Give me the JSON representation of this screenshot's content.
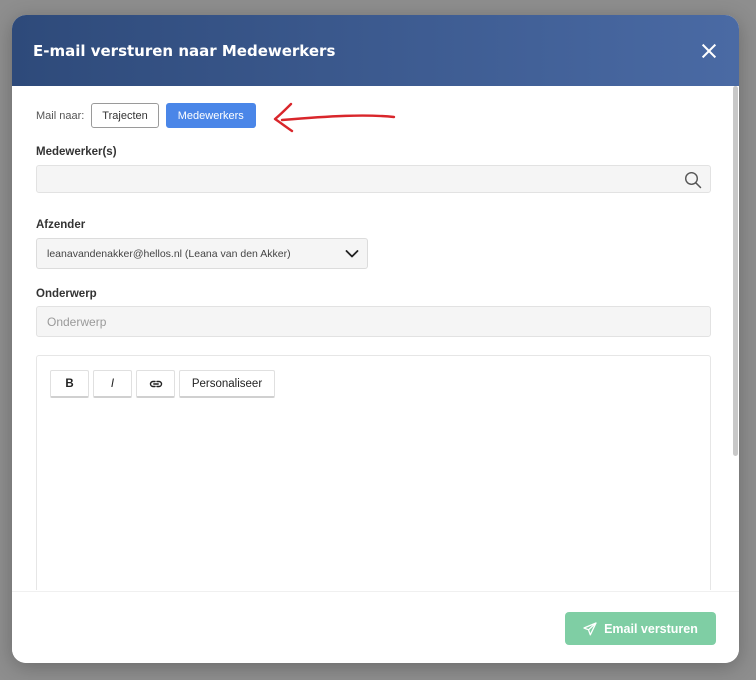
{
  "modal": {
    "title": "E-mail versturen naar Medewerkers"
  },
  "mail_to": {
    "label": "Mail naar:",
    "options": [
      "Trajecten",
      "Medewerkers"
    ],
    "selected": "Medewerkers"
  },
  "medewerkers": {
    "label": "Medewerker(s)",
    "value": ""
  },
  "afzender": {
    "label": "Afzender",
    "value": "leanavandenakker@hellos.nl (Leana van den Akker)"
  },
  "onderwerp": {
    "label": "Onderwerp",
    "placeholder": "Onderwerp",
    "value": ""
  },
  "editor": {
    "toolbar": {
      "bold": "B",
      "italic": "I",
      "link_icon": "link-icon",
      "personalize": "Personaliseer"
    },
    "content": ""
  },
  "footer": {
    "send_label": "Email versturen",
    "send_icon": "paper-plane-icon"
  },
  "colors": {
    "header_start": "#2e4a7a",
    "header_end": "#4a6aa4",
    "toggle_active": "#4a86e8",
    "send_button": "#7fcea4",
    "annotation_arrow": "#d9262b"
  }
}
